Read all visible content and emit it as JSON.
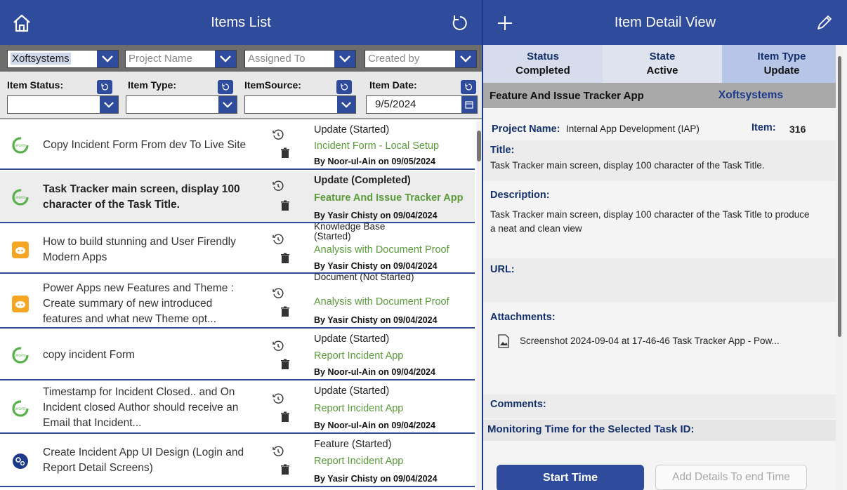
{
  "left": {
    "title": "Items List",
    "filters": {
      "company_value": "Xoftsystems",
      "project_placeholder": "Project Name",
      "assigned_placeholder": "Assigned To",
      "created_placeholder": "Created by",
      "item_status_label": "Item Status:",
      "item_type_label": "Item Type:",
      "item_source_label": "ItemSource:",
      "item_date_label": "Item Date:",
      "item_date_value": "9/5/2024"
    },
    "items": [
      {
        "title": "Copy Incident Form From dev To Live Site",
        "type": "Update (Started)",
        "project": "Incident Form - Local Setup",
        "by": "By Noor-ul-Ain on 09/05/2024",
        "icon": "update-icon"
      },
      {
        "title": "Task Tracker main screen, display 100 character of the Task Title.",
        "type": "Update (Completed)",
        "project": "Feature And Issue Tracker App",
        "by": "By Yasir Chisty on 09/04/2024",
        "icon": "update-icon"
      },
      {
        "title": "How to build stunning and User Firendly Modern Apps",
        "type": "Knowledge Base (Started)",
        "project": "Analysis with Document Proof",
        "by": "By Yasir Chisty on 09/04/2024",
        "icon": "discord-icon"
      },
      {
        "title": "Power Apps new Features and Theme : Create summary of new introduced features and what new Theme opt...",
        "type": "Document (Not Started)",
        "project": "Analysis with Document Proof",
        "by": "By Yasir Chisty on 09/04/2024",
        "icon": "discord-icon"
      },
      {
        "title": "copy incident Form",
        "type": "Update (Started)",
        "project": "Report Incident App",
        "by": "By Noor-ul-Ain on 09/04/2024",
        "icon": "update-icon"
      },
      {
        "title": "Timestamp for Incident Closed.. and On Incident closed Author should receive an Email that Incident...",
        "type": "Update (Started)",
        "project": "Report Incident App",
        "by": "By Noor-ul-Ain on 09/04/2024",
        "icon": "update-icon"
      },
      {
        "title": "Create Incident App UI Design (Login and Report Detail Screens)",
        "type": "Feature (Started)",
        "project": "Report Incident App",
        "by": "By Yasir Chisty on 09/04/2024",
        "icon": "feature-icon"
      }
    ]
  },
  "right": {
    "title": "Item Detail View",
    "status_label": "Status",
    "status_value": "Completed",
    "state_label": "State",
    "state_value": "Active",
    "type_label": "Item Type",
    "type_value": "Update",
    "project_app": "Feature And Issue Tracker App",
    "company": "Xoftsystems",
    "project_name_label": "Project Name:",
    "project_name_value": "Internal App Development (IAP)",
    "item_label": "Item:",
    "item_value": "316",
    "title_label": "Title:",
    "title_value": "Task Tracker main screen, display 100 character of the Task Title.",
    "description_label": "Description:",
    "description_value": "Task Tracker main screen, display 100 character of the Task Title to produce a neat and clean view",
    "url_label": "URL:",
    "attachments_label": "Attachments:",
    "attachment_name": "Screenshot 2024-09-04 at 17-46-46 Task Tracker App - Pow...",
    "comments_label": "Comments:",
    "monitoring_label": "Monitoring Time for the Selected Task ID:",
    "start_button": "Start Time",
    "add_details_button": "Add Details To end Time"
  },
  "colors": {
    "header": "#2f4b9c",
    "project_text": "#5a9b3a",
    "label_text": "#14306e"
  }
}
